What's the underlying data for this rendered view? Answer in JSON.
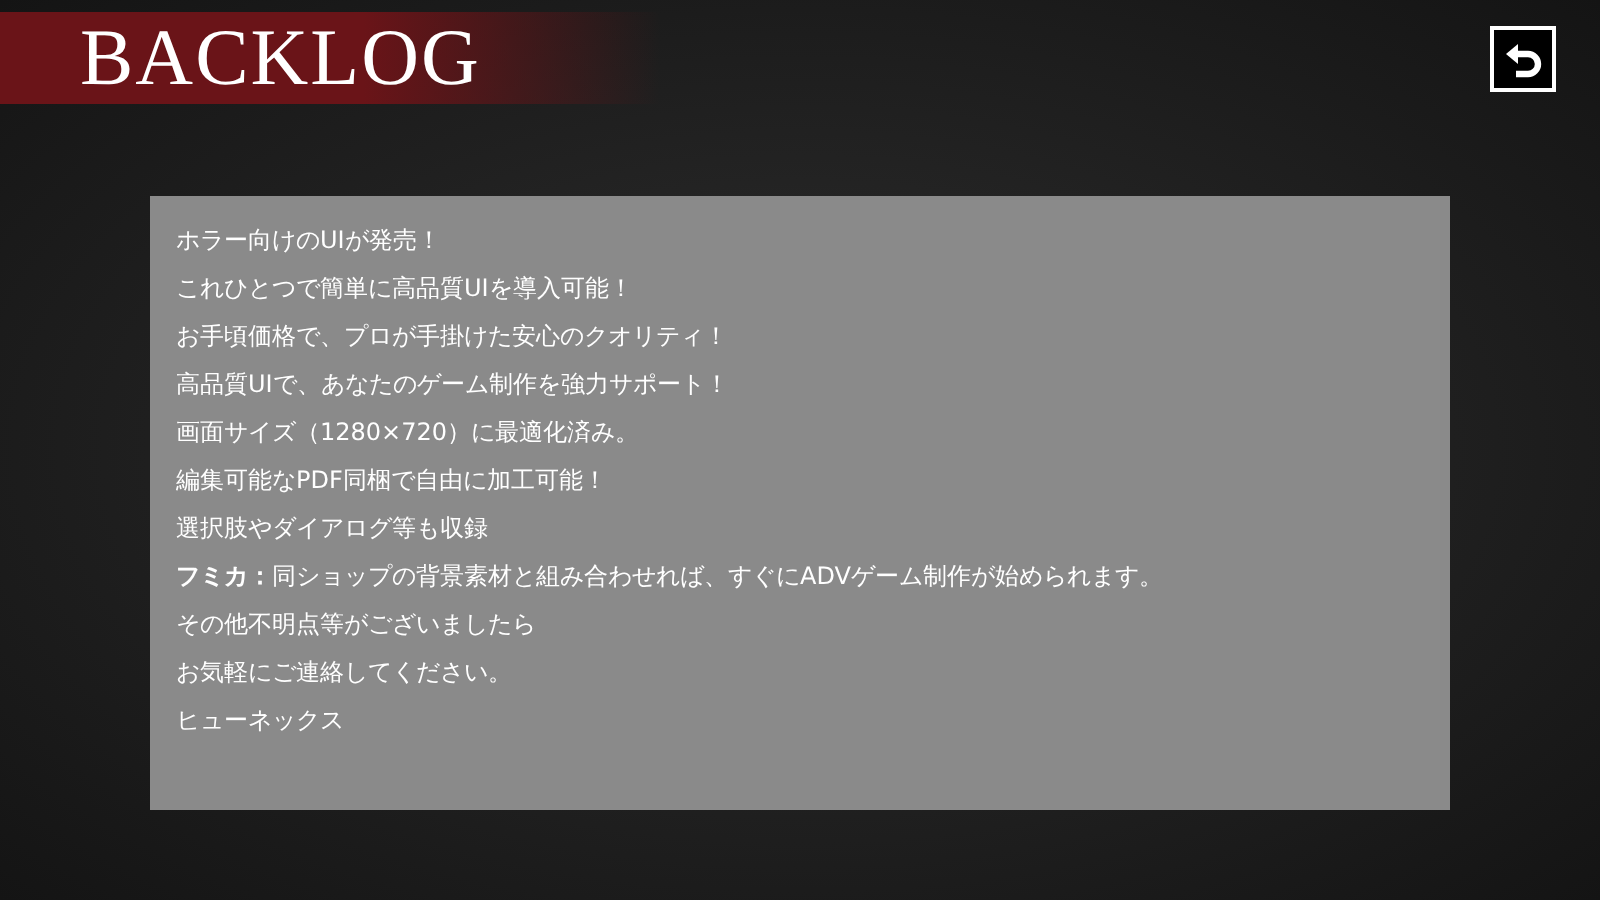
{
  "header": {
    "title": "BACKLOG"
  },
  "back_button": {
    "kind": "return"
  },
  "log": [
    "ホラー向けのUIが発売！",
    "これひとつで簡単に高品質UIを導入可能！",
    "お手頃価格で、プロが手掛けた安心のクオリティ！",
    "高品質UIで、あなたのゲーム制作を強力サポート！",
    "画面サイズ（1280×720）に最適化済み。",
    "編集可能なPDF同梱で自由に加工可能！",
    "選択肢やダイアログ等も収録",
    "**フミカ：**同ショップの背景素材と組み合わせれば、すぐにADVゲーム制作が始められます。",
    "その他不明点等がございましたら",
    "お気軽にご連絡してください。",
    "ヒューネックス"
  ]
}
